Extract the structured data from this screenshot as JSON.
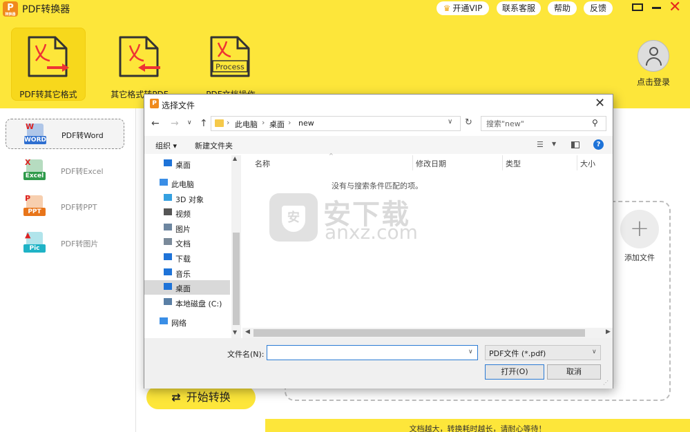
{
  "app": {
    "logo_text": "P",
    "logo_sub": "转换器",
    "title": "PDF转换器"
  },
  "top_buttons": {
    "vip": "开通VIP",
    "service": "联系客服",
    "help": "帮助",
    "feedback": "反馈"
  },
  "window_controls": {
    "maximize_icon": "maximize-icon",
    "minimize_icon": "minimize-icon",
    "close_symbol": "✕"
  },
  "toolbar": {
    "items": [
      {
        "label": "PDF转其它格式",
        "icon": "pdf-export-icon",
        "active": true
      },
      {
        "label": "其它格式转PDF",
        "icon": "pdf-import-icon",
        "active": false
      },
      {
        "label": "PDF文档操作",
        "icon": "pdf-process-icon",
        "badge": "Process",
        "active": false
      }
    ],
    "login_label": "点击登录"
  },
  "sidebar": {
    "items": [
      {
        "label": "PDF转Word",
        "tag": "WORD",
        "tag_color": "#2f6fd0",
        "mark": "W",
        "active": true
      },
      {
        "label": "PDF转Excel",
        "tag": "Excel",
        "tag_color": "#2e9a4a",
        "mark": "X",
        "active": false
      },
      {
        "label": "PDF转PPT",
        "tag": "PPT",
        "tag_color": "#e8751a",
        "mark": "P",
        "active": false
      },
      {
        "label": "PDF转图片",
        "tag": "Pic",
        "tag_color": "#1fb3c6",
        "mark": "▲",
        "active": false
      }
    ]
  },
  "main": {
    "start_button": "开始转换",
    "add_file_label": "添加文件",
    "bottom_notice": "文档越大，转换耗时越长，请耐心等待！"
  },
  "dialog": {
    "title": "选择文件",
    "address": {
      "crumbs": [
        "此电脑",
        "桌面",
        "new"
      ]
    },
    "search_placeholder": "搜索\"new\"",
    "commands": {
      "organize": "组织 ▾",
      "new_folder": "新建文件夹"
    },
    "nav_items": [
      {
        "label": "桌面",
        "icon": "desktop-icon",
        "color": "#1e73d8",
        "indent": 2
      },
      {
        "label": "此电脑",
        "icon": "pc-icon",
        "color": "#3a8ee6",
        "indent": 1
      },
      {
        "label": "3D 对象",
        "icon": "3d-objects-icon",
        "color": "#35a0e0",
        "indent": 2
      },
      {
        "label": "视频",
        "icon": "video-icon",
        "color": "#555555",
        "indent": 2
      },
      {
        "label": "图片",
        "icon": "pictures-icon",
        "color": "#6d86a0",
        "indent": 2
      },
      {
        "label": "文档",
        "icon": "documents-icon",
        "color": "#7a8a9a",
        "indent": 2
      },
      {
        "label": "下载",
        "icon": "downloads-icon",
        "color": "#1e73d8",
        "indent": 2
      },
      {
        "label": "音乐",
        "icon": "music-icon",
        "color": "#1e73d8",
        "indent": 2
      },
      {
        "label": "桌面",
        "icon": "desktop-icon",
        "color": "#1e73d8",
        "indent": 2,
        "selected": true
      },
      {
        "label": "本地磁盘 (C:)",
        "icon": "drive-icon",
        "color": "#5a7fa5",
        "indent": 2
      },
      {
        "label": "网络",
        "icon": "network-icon",
        "color": "#3a8ee6",
        "indent": 1
      }
    ],
    "columns": [
      "名称",
      "修改日期",
      "类型",
      "大小"
    ],
    "empty_message": "没有与搜索条件匹配的项。",
    "filename_label": "文件名(N):",
    "filename_value": "",
    "filetype": "PDF文件 (*.pdf)",
    "open_button": "打开(O)",
    "cancel_button": "取消"
  },
  "watermark": {
    "text": "安下载",
    "url": "anxz.com",
    "logo_char": "安"
  }
}
